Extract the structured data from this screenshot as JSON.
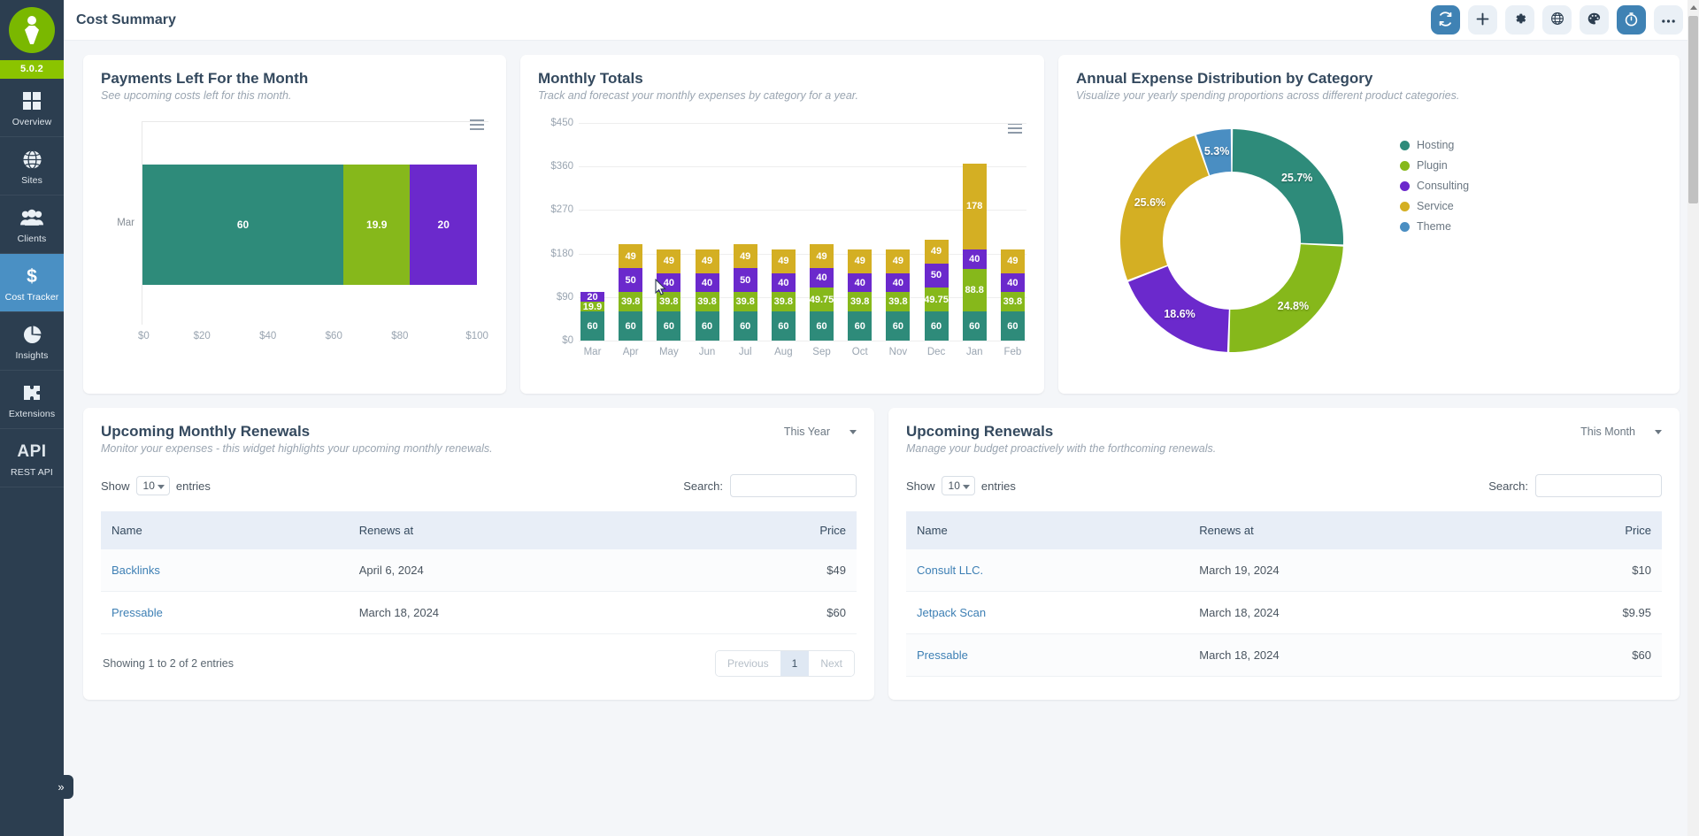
{
  "sidebar": {
    "version": "5.0.2",
    "items": [
      {
        "label": "Overview",
        "icon": "grid-icon"
      },
      {
        "label": "Sites",
        "icon": "globe-icon"
      },
      {
        "label": "Clients",
        "icon": "users-icon"
      },
      {
        "label": "Cost Tracker",
        "icon": "dollar-icon"
      },
      {
        "label": "Insights",
        "icon": "pie-chart-icon"
      },
      {
        "label": "Extensions",
        "icon": "puzzle-icon"
      },
      {
        "label": "REST API",
        "icon": "api-text-icon",
        "glyph": "API"
      }
    ],
    "active_index": 3,
    "collapse_glyph": "»"
  },
  "header": {
    "title": "Cost Summary",
    "actions": [
      {
        "name": "refresh",
        "active": true
      },
      {
        "name": "add",
        "active": false
      },
      {
        "name": "settings",
        "active": false
      },
      {
        "name": "globe",
        "active": false
      },
      {
        "name": "theme",
        "active": false
      },
      {
        "name": "timer",
        "active": true
      },
      {
        "name": "more",
        "active": false
      }
    ]
  },
  "colors": {
    "hosting": "#2e8b7a",
    "plugin": "#86b81b",
    "consulting": "#6b29cc",
    "service": "#d4af23",
    "theme": "#4a8ec2",
    "accent_blue": "#3f82b4",
    "sidebar_bg": "#2c3e50",
    "version_bg": "#8bc400"
  },
  "cards": {
    "payments_left": {
      "title": "Payments Left For the Month",
      "subtitle": "See upcoming costs left for this month."
    },
    "monthly_totals": {
      "title": "Monthly Totals",
      "subtitle": "Track and forecast your monthly expenses by category for a year."
    },
    "annual_distribution": {
      "title": "Annual Expense Distribution by Category",
      "subtitle": "Visualize your yearly spending proportions across different product categories."
    }
  },
  "chart_data": [
    {
      "type": "bar",
      "orientation": "horizontal",
      "title": "Payments Left For the Month",
      "categories": [
        "Mar"
      ],
      "series": [
        {
          "name": "Hosting",
          "values": [
            60
          ],
          "color": "#2e8b7a"
        },
        {
          "name": "Plugin",
          "values": [
            19.9
          ],
          "color": "#86b81b"
        },
        {
          "name": "Consulting",
          "values": [
            20
          ],
          "color": "#6b29cc"
        }
      ],
      "stacked": true,
      "xlabel": "",
      "ylabel": "",
      "xticks": [
        "$0",
        "$20",
        "$40",
        "$60",
        "$80",
        "$100"
      ],
      "xlim": [
        0,
        100
      ],
      "grid": false
    },
    {
      "type": "bar",
      "orientation": "vertical",
      "stacked": true,
      "title": "Monthly Totals",
      "categories": [
        "Mar",
        "Apr",
        "May",
        "Jun",
        "Jul",
        "Aug",
        "Sep",
        "Oct",
        "Nov",
        "Dec",
        "Jan",
        "Feb"
      ],
      "series": [
        {
          "name": "Hosting",
          "color": "#2e8b7a",
          "values": [
            60,
            60,
            60,
            60,
            60,
            60,
            60,
            60,
            60,
            60,
            60,
            60
          ]
        },
        {
          "name": "Plugin",
          "color": "#86b81b",
          "values": [
            19.9,
            39.8,
            39.8,
            39.8,
            39.8,
            39.8,
            49.75,
            39.8,
            39.8,
            49.75,
            88.8,
            39.8
          ]
        },
        {
          "name": "Consulting",
          "color": "#6b29cc",
          "values": [
            20,
            50,
            40,
            40,
            50,
            40,
            40,
            40,
            40,
            50,
            40,
            40
          ]
        },
        {
          "name": "Service",
          "color": "#d4af23",
          "values": [
            0,
            49,
            49,
            49,
            49,
            49,
            49,
            49,
            49,
            49,
            178,
            49
          ]
        }
      ],
      "yticks": [
        "$0",
        "$90",
        "$180",
        "$270",
        "$360",
        "$450"
      ],
      "ylim": [
        0,
        450
      ],
      "grid": true
    },
    {
      "type": "pie",
      "variant": "donut",
      "title": "Annual Expense Distribution by Category",
      "labels": [
        "Hosting",
        "Plugin",
        "Consulting",
        "Service",
        "Theme"
      ],
      "values": [
        25.7,
        24.8,
        18.6,
        25.6,
        5.3
      ],
      "value_labels": [
        "25.7%",
        "24.8%",
        "18.6%",
        "25.6%",
        "5.3%"
      ],
      "colors": [
        "#2e8b7a",
        "#86b81b",
        "#6b29cc",
        "#d4af23",
        "#4a8ec2"
      ],
      "legend_position": "right"
    }
  ],
  "tables": [
    {
      "title": "Upcoming Monthly Renewals",
      "subtitle": "Monitor your expenses - this widget highlights your upcoming monthly renewals.",
      "period": "This Year",
      "show_label": "Show",
      "entries_label": "entries",
      "page_size": "10",
      "search_label": "Search:",
      "search_value": "",
      "search_placeholder": "",
      "columns": [
        "Name",
        "Renews at",
        "Price"
      ],
      "rows": [
        {
          "name": "Backlinks",
          "renews_at": "April 6, 2024",
          "price": "$49"
        },
        {
          "name": "Pressable",
          "renews_at": "March 18, 2024",
          "price": "$60"
        }
      ],
      "showing": "Showing 1 to 2 of 2 entries",
      "pager": {
        "previous": "Previous",
        "current": "1",
        "next": "Next"
      }
    },
    {
      "title": "Upcoming Renewals",
      "subtitle": "Manage your budget proactively with the forthcoming renewals.",
      "period": "This Month",
      "show_label": "Show",
      "entries_label": "entries",
      "page_size": "10",
      "search_label": "Search:",
      "search_value": "",
      "search_placeholder": "",
      "columns": [
        "Name",
        "Renews at",
        "Price"
      ],
      "rows": [
        {
          "name": "Consult LLC.",
          "renews_at": "March 19, 2024",
          "price": "$10"
        },
        {
          "name": "Jetpack Scan",
          "renews_at": "March 18, 2024",
          "price": "$9.95"
        },
        {
          "name": "Pressable",
          "renews_at": "March 18, 2024",
          "price": "$60"
        }
      ],
      "showing": "",
      "pager": null
    }
  ]
}
